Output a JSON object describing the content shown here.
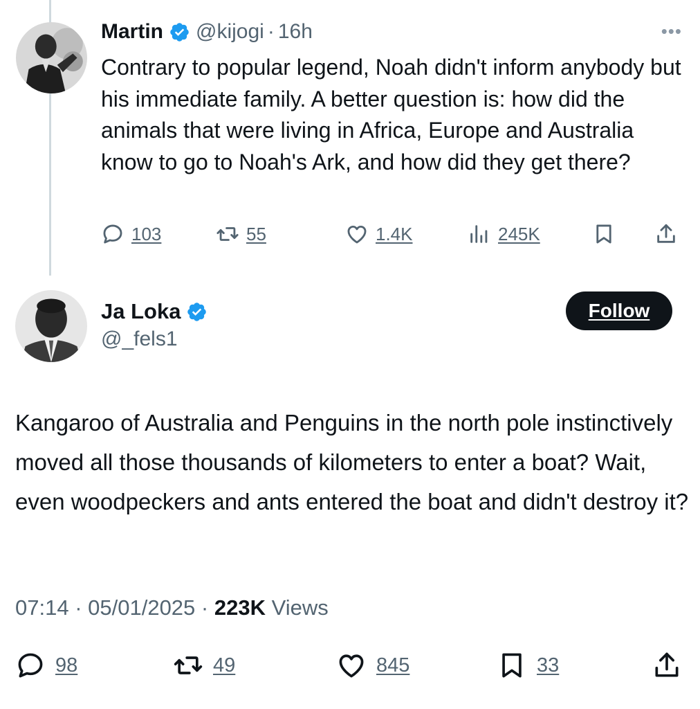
{
  "parent": {
    "name": "Martin",
    "handle": "@kijogi",
    "time": "16h",
    "more": "•••",
    "text": "Contrary to popular legend, Noah didn't inform anybody but his immediate family. A better question is: how did the animals that were living in Africa, Europe and Australia know to go to Noah's Ark, and how did they get there?",
    "actions": {
      "replies": "103",
      "reposts": "55",
      "likes": "1.4K",
      "views": "245K"
    }
  },
  "reply": {
    "name": "Ja Loka",
    "handle": "@_fels1",
    "follow_label": "Follow",
    "text": "Kangaroo of Australia and Penguins in the north pole instinctively moved all those thousands of kilometers to enter a boat? Wait, even woodpeckers and ants entered the boat and didn't destroy it?",
    "time": "07:14",
    "date": "05/01/2025",
    "views_count": "223K",
    "views_label": "Views",
    "actions": {
      "replies": "98",
      "reposts": "49",
      "likes": "845",
      "bookmarks": "33"
    }
  },
  "colors": {
    "verified": "#1d9bf0",
    "muted": "#536471",
    "text": "#0f1419",
    "thread_line": "#cfd9de"
  }
}
